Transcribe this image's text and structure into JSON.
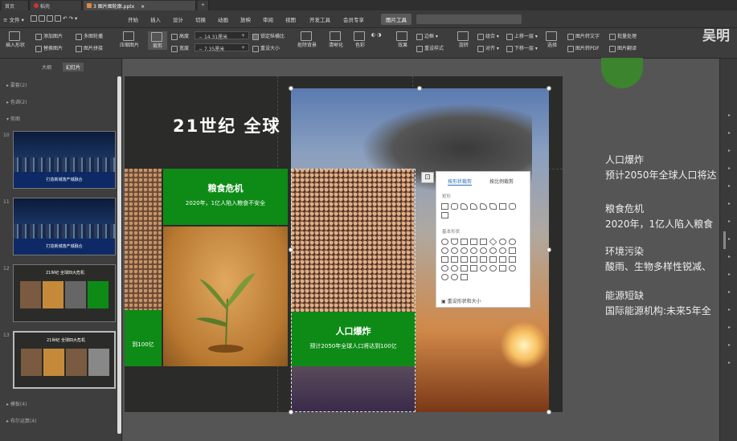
{
  "tabs": [
    {
      "label": "首页"
    },
    {
      "label": "稻壳"
    },
    {
      "label": "3 图片图轮廓.pptx"
    }
  ],
  "menu": {
    "file": "文件",
    "items": [
      "开始",
      "插入",
      "设计",
      "切换",
      "动画",
      "放映",
      "审阅",
      "视图",
      "开发工具",
      "会员专享"
    ],
    "picture_tools": "图片工具"
  },
  "toolbar": {
    "insert_shape": "插入形状",
    "add_picture": "添加图片",
    "replace_picture": "替换图片",
    "multi_crop": "多图轮播",
    "picture_splice": "图片拼接",
    "compress": "压缩图片",
    "crop": "裁剪",
    "height_label": "高度",
    "height_value": "14.31厘米",
    "width_label": "宽度",
    "width_value": "7.35厘米",
    "lock_ratio": "锁定纵横比",
    "reset_size": "重设大小",
    "remove_bg": "抠除背景",
    "brightness": "清晰化",
    "color": "色彩",
    "effects": "效果",
    "reset_style": "重设样式",
    "border": "边框",
    "rotate": "旋转",
    "combine": "组合",
    "align": "对齐",
    "bring_forward": "上移一层",
    "send_backward": "下移一层",
    "select": "选择",
    "pic_to_text": "图片转文字",
    "pic_to_pdf": "图片转PDF",
    "batch": "批量处理",
    "translate": "图片翻译",
    "brand": "吴明"
  },
  "left_panel": {
    "tab_outline": "大纲",
    "tab_slides": "幻灯片",
    "sections": {
      "cover": "要套(2)",
      "color": "色调(2)",
      "cut": "剪图",
      "template": "模板(4)",
      "layout": "布尔运算(4)"
    },
    "slides": [
      {
        "num": "10",
        "title": "打造新城落产城融合"
      },
      {
        "num": "11",
        "title": "打造新城落产城融合"
      },
      {
        "num": "12",
        "title": "21世纪 全球四大危机"
      },
      {
        "num": "13",
        "title": "21世纪 全球四大危机"
      }
    ]
  },
  "slide": {
    "title": "21世纪  全球",
    "food_title": "粮食危机",
    "food_sub": "2020年，1亿人陷入粮食不安全",
    "left_sub": "到100亿",
    "pop_title": "人口爆炸",
    "pop_sub": "预计2050年全球人口将达到100亿"
  },
  "popup": {
    "tab_shape": "按形状裁剪",
    "tab_ratio": "按比例裁剪",
    "group_rect": "矩形",
    "group_basic": "基本形状",
    "footer": "重设形状和大小"
  },
  "notes": [
    {
      "title": "人口爆炸",
      "sub": "预计2050年全球人口将达"
    },
    {
      "title": "粮食危机",
      "sub": "2020年，1亿人陷入粮食"
    },
    {
      "title": "环境污染",
      "sub": "酸雨、生物多样性锐减、"
    },
    {
      "title": "能源短缺",
      "sub": "国际能源机构:未来5年全"
    }
  ],
  "colors": {
    "green_box": "#0d8b16",
    "slide_bg": "#2b2b29",
    "accent_blue": "#2a6ebd"
  }
}
